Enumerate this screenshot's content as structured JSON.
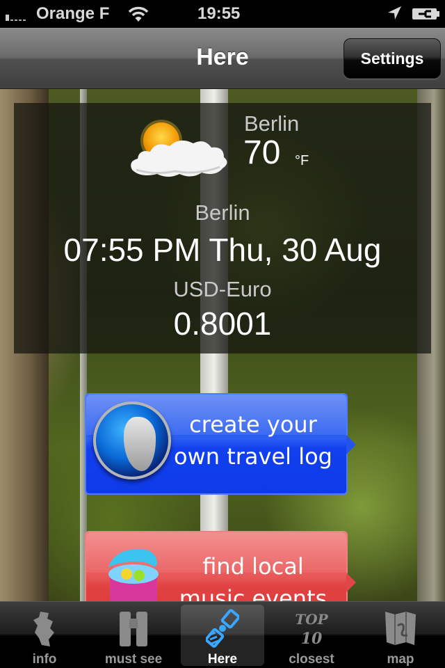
{
  "status_bar": {
    "carrier": "Orange F",
    "time": "19:55",
    "icons": [
      "signal-icon",
      "wifi-icon",
      "location-arrow-icon",
      "battery-charging-icon"
    ]
  },
  "nav": {
    "title": "Here",
    "settings_label": "Settings"
  },
  "weather": {
    "icon": "partly-cloudy-icon",
    "city": "Berlin",
    "temperature": "70",
    "unit": "°F"
  },
  "local_time": {
    "city": "Berlin",
    "value": "07:55 PM Thu, 30 Aug"
  },
  "currency": {
    "label": "USD-Euro",
    "value": "0.8001"
  },
  "promos": [
    {
      "icon": "globe-icon",
      "line1": "create your",
      "line2": "own travel log",
      "color": "#1f4ef0"
    },
    {
      "icon": "music-bucket-icon",
      "line1": "find local",
      "line2": "music events",
      "color": "#e04848"
    }
  ],
  "tabs": [
    {
      "label": "info",
      "icon": "info-map-icon",
      "active": false
    },
    {
      "label": "must see",
      "icon": "binoculars-icon",
      "active": false
    },
    {
      "label": "Here",
      "icon": "satellite-icon",
      "active": true
    },
    {
      "label": "closest",
      "icon": "top10-icon",
      "active": false
    },
    {
      "label": "map",
      "icon": "folded-map-icon",
      "active": false
    }
  ],
  "colors": {
    "active_tab_icon": "#3aa6ff",
    "inactive_tab": "#9a9a9a"
  }
}
